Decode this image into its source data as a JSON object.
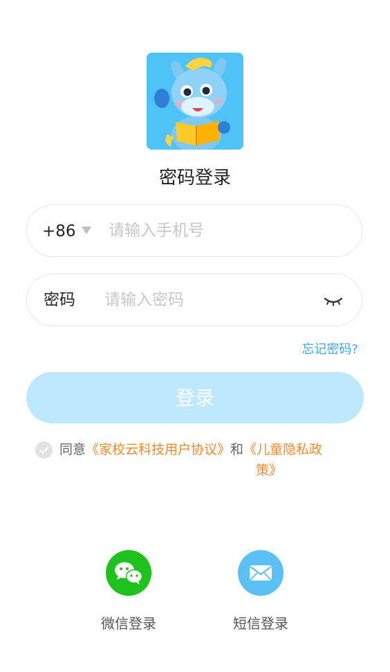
{
  "header": {
    "title": "密码登录"
  },
  "phone": {
    "country_code": "+86",
    "placeholder": "请输入手机号"
  },
  "password": {
    "label": "密码",
    "placeholder": "请输入密码"
  },
  "forgot": {
    "label": "忘记密码?"
  },
  "login": {
    "button_label": "登录"
  },
  "agreement": {
    "prefix": "同意",
    "user_agreement": "《家校云科技用户协议》",
    "and": "和",
    "privacy_part1": "《儿童隐私政",
    "privacy_part2": "策》"
  },
  "social": {
    "wechat_label": "微信登录",
    "sms_label": "短信登录"
  },
  "colors": {
    "accent": "#3fa8e6",
    "button_disabled": "#bde8fd",
    "link_orange": "#f08c2a",
    "wechat_green": "#1dc21d",
    "sms_blue": "#5bc0f5"
  }
}
